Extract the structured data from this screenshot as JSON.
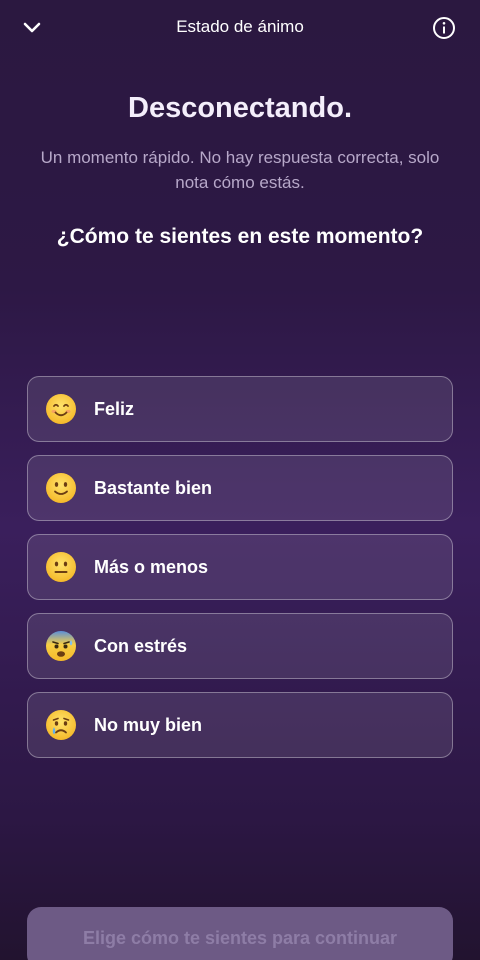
{
  "header": {
    "title": "Estado de ánimo",
    "back_icon": "chevron-down-icon",
    "info_icon": "info-icon"
  },
  "main": {
    "headline": "Desconectando.",
    "subtitle": "Un momento rápido. No hay respuesta correcta, solo nota cómo estás.",
    "question": "¿Cómo te sientes en este momento?"
  },
  "options": [
    {
      "label": "Feliz",
      "icon": "smiling-face-icon"
    },
    {
      "label": "Bastante bien",
      "icon": "slightly-smiling-face-icon"
    },
    {
      "label": "Más o menos",
      "icon": "neutral-face-icon"
    },
    {
      "label": "Con estrés",
      "icon": "anxious-sweat-face-icon"
    },
    {
      "label": "No muy bien",
      "icon": "crying-face-icon"
    }
  ],
  "footer": {
    "continue_label": "Elige cómo te sientes para continuar"
  },
  "colors": {
    "background": "#2d1845",
    "card_border": "#8a7a9e",
    "button_disabled": "#6d5a85"
  }
}
